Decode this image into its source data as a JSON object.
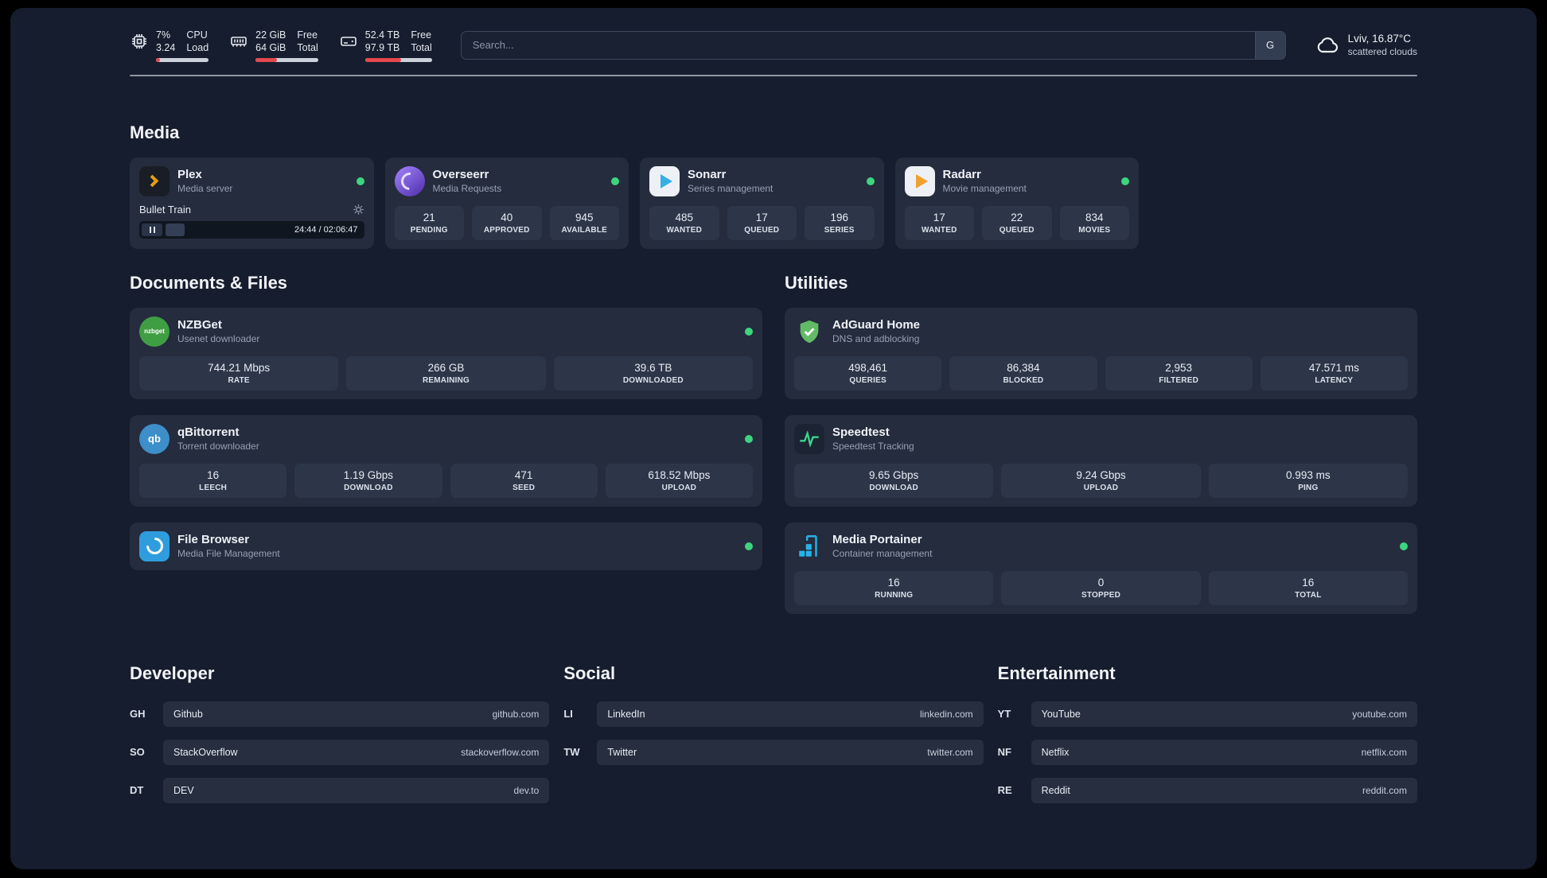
{
  "topbar": {
    "cpu": {
      "values": [
        "7%",
        "3.24"
      ],
      "labels": [
        "CPU",
        "Load"
      ],
      "percent": 7
    },
    "ram": {
      "values": [
        "22 GiB",
        "64 GiB"
      ],
      "labels": [
        "Free",
        "Total"
      ],
      "percent": 34
    },
    "disk": {
      "values": [
        "52.4 TB",
        "97.9 TB"
      ],
      "labels": [
        "Free",
        "Total"
      ],
      "percent": 54
    },
    "search": {
      "placeholder": "Search...",
      "engine_label": "G"
    },
    "weather": {
      "location": "Lviv, 16.87°C",
      "condition": "scattered clouds"
    }
  },
  "media": {
    "heading": "Media",
    "plex": {
      "title": "Plex",
      "subtitle": "Media server",
      "now_playing": "Bullet Train",
      "time": "24:44 / 02:06:47",
      "progress_percent": 16
    },
    "overseerr": {
      "title": "Overseerr",
      "subtitle": "Media Requests",
      "stats": [
        {
          "value": "21",
          "label": "PENDING"
        },
        {
          "value": "40",
          "label": "APPROVED"
        },
        {
          "value": "945",
          "label": "AVAILABLE"
        }
      ]
    },
    "sonarr": {
      "title": "Sonarr",
      "subtitle": "Series management",
      "stats": [
        {
          "value": "485",
          "label": "WANTED"
        },
        {
          "value": "17",
          "label": "QUEUED"
        },
        {
          "value": "196",
          "label": "SERIES"
        }
      ]
    },
    "radarr": {
      "title": "Radarr",
      "subtitle": "Movie management",
      "stats": [
        {
          "value": "17",
          "label": "WANTED"
        },
        {
          "value": "22",
          "label": "QUEUED"
        },
        {
          "value": "834",
          "label": "MOVIES"
        }
      ]
    }
  },
  "documents": {
    "heading": "Documents & Files",
    "nzbget": {
      "title": "NZBGet",
      "subtitle": "Usenet downloader",
      "icon_text": "nzbget",
      "stats": [
        {
          "value": "744.21 Mbps",
          "label": "RATE"
        },
        {
          "value": "266 GB",
          "label": "REMAINING"
        },
        {
          "value": "39.6 TB",
          "label": "DOWNLOADED"
        }
      ]
    },
    "qbittorrent": {
      "title": "qBittorrent",
      "subtitle": "Torrent downloader",
      "icon_text": "qb",
      "stats": [
        {
          "value": "16",
          "label": "LEECH"
        },
        {
          "value": "1.19 Gbps",
          "label": "DOWNLOAD"
        },
        {
          "value": "471",
          "label": "SEED"
        },
        {
          "value": "618.52 Mbps",
          "label": "UPLOAD"
        }
      ]
    },
    "filebrowser": {
      "title": "File Browser",
      "subtitle": "Media File Management"
    }
  },
  "utilities": {
    "heading": "Utilities",
    "adguard": {
      "title": "AdGuard Home",
      "subtitle": "DNS and adblocking",
      "stats": [
        {
          "value": "498,461",
          "label": "QUERIES"
        },
        {
          "value": "86,384",
          "label": "BLOCKED"
        },
        {
          "value": "2,953",
          "label": "FILTERED"
        },
        {
          "value": "47.571 ms",
          "label": "LATENCY"
        }
      ]
    },
    "speedtest": {
      "title": "Speedtest",
      "subtitle": "Speedtest Tracking",
      "stats": [
        {
          "value": "9.65 Gbps",
          "label": "DOWNLOAD"
        },
        {
          "value": "9.24 Gbps",
          "label": "UPLOAD"
        },
        {
          "value": "0.993 ms",
          "label": "PING"
        }
      ]
    },
    "portainer": {
      "title": "Media Portainer",
      "subtitle": "Container management",
      "stats": [
        {
          "value": "16",
          "label": "RUNNING"
        },
        {
          "value": "0",
          "label": "STOPPED"
        },
        {
          "value": "16",
          "label": "TOTAL"
        }
      ]
    }
  },
  "bookmarks": {
    "developer": {
      "heading": "Developer",
      "items": [
        {
          "abbr": "GH",
          "name": "Github",
          "url": "github.com"
        },
        {
          "abbr": "SO",
          "name": "StackOverflow",
          "url": "stackoverflow.com"
        },
        {
          "abbr": "DT",
          "name": "DEV",
          "url": "dev.to"
        }
      ]
    },
    "social": {
      "heading": "Social",
      "items": [
        {
          "abbr": "LI",
          "name": "LinkedIn",
          "url": "linkedin.com"
        },
        {
          "abbr": "TW",
          "name": "Twitter",
          "url": "twitter.com"
        }
      ]
    },
    "entertainment": {
      "heading": "Entertainment",
      "items": [
        {
          "abbr": "YT",
          "name": "YouTube",
          "url": "youtube.com"
        },
        {
          "abbr": "NF",
          "name": "Netflix",
          "url": "netflix.com"
        },
        {
          "abbr": "RE",
          "name": "Reddit",
          "url": "reddit.com"
        }
      ]
    }
  }
}
